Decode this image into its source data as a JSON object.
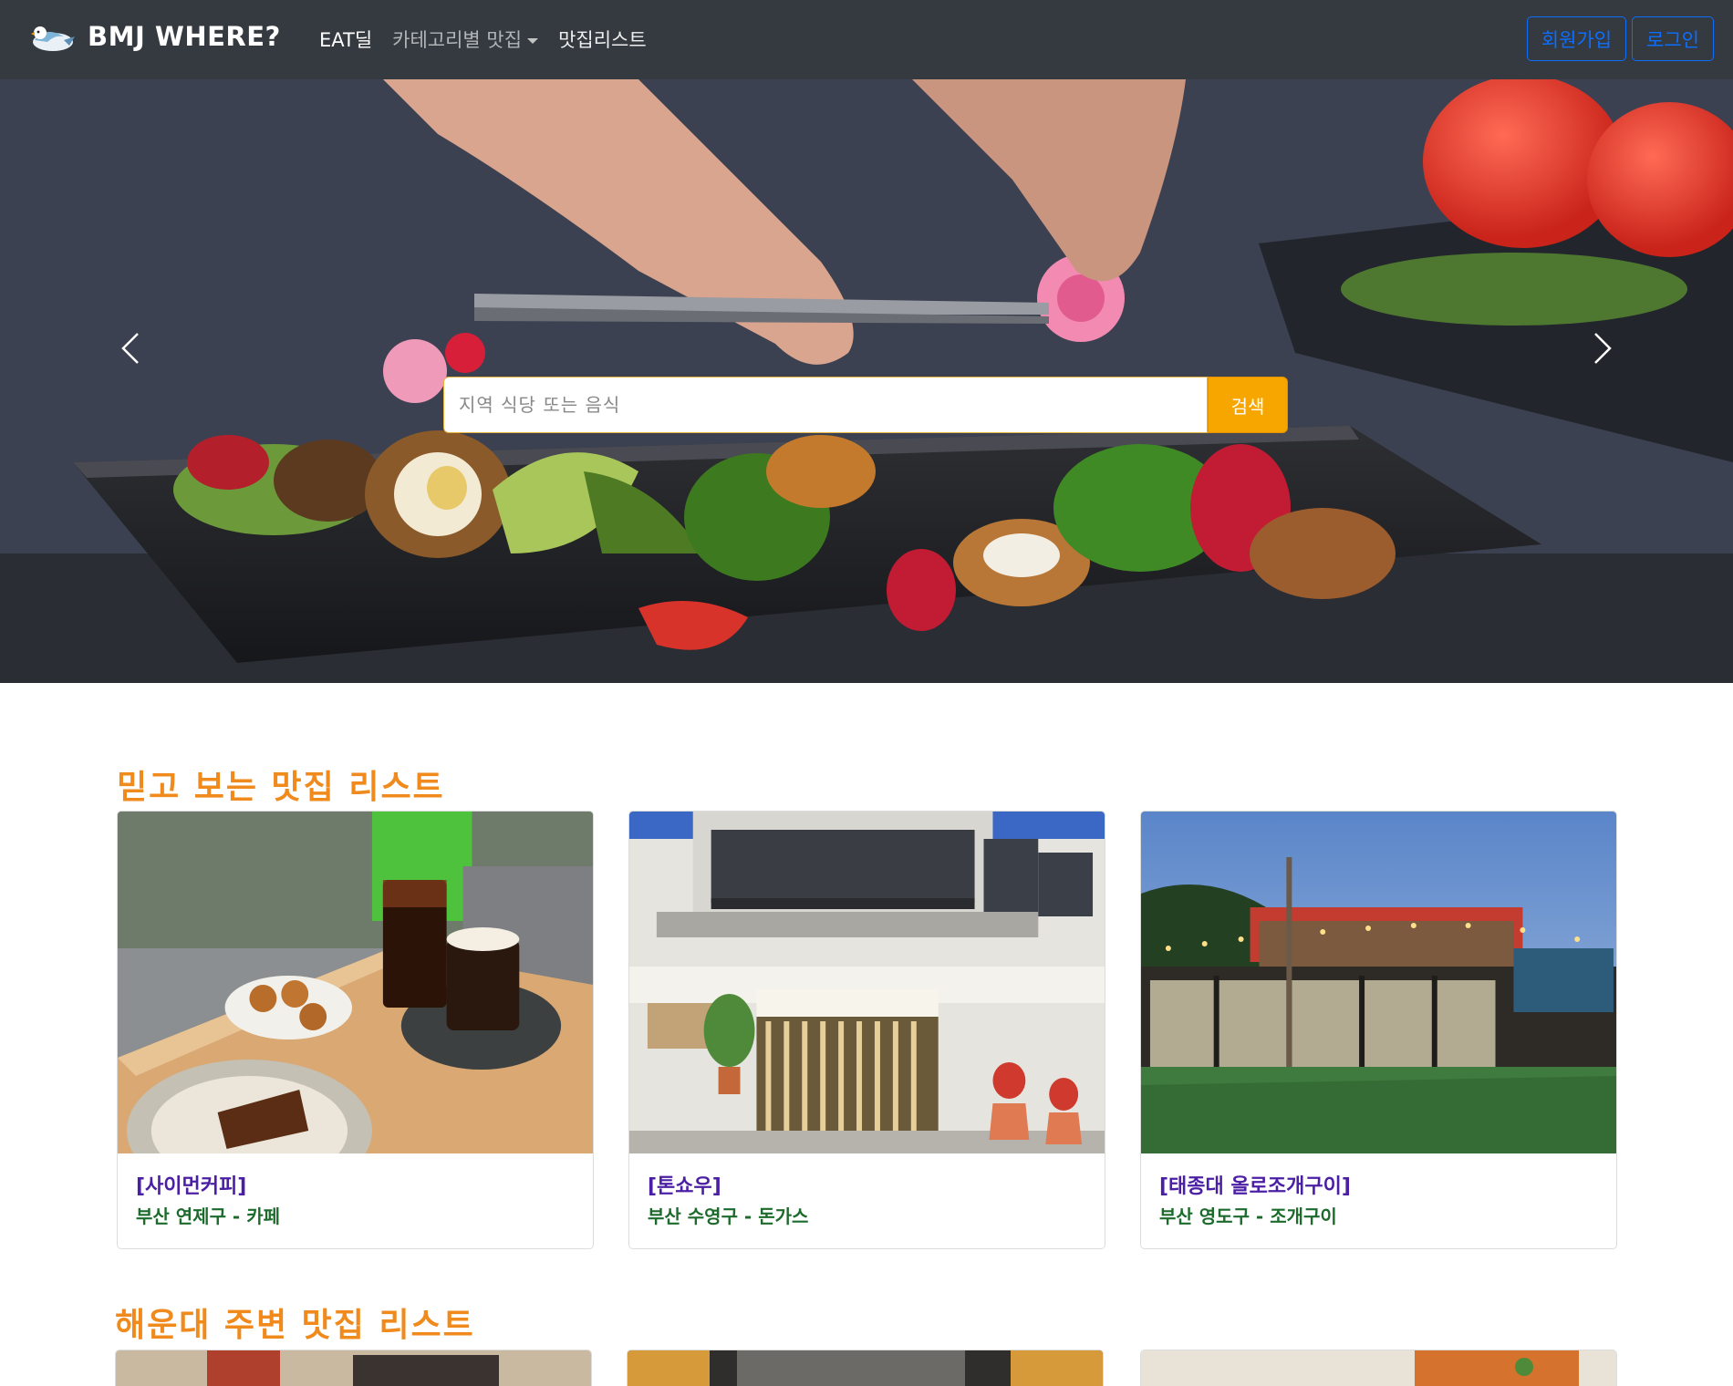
{
  "navbar": {
    "brand": "BMJ WHERE?",
    "links": [
      {
        "label": "EAT딜"
      },
      {
        "label": "카테고리별 맛집"
      },
      {
        "label": "맛집리스트"
      }
    ],
    "signup_label": "회원가입",
    "login_label": "로그인"
  },
  "hero": {
    "search_placeholder": "지역 식당 또는 음식",
    "search_button": "검색"
  },
  "sections": [
    {
      "title": "믿고 보는 맛집 리스트",
      "cards": [
        {
          "title": "[사이먼커피]",
          "subtitle": "부산 연제구 - 카페"
        },
        {
          "title": "[톤쇼우]",
          "subtitle": "부산 수영구 - 돈가스"
        },
        {
          "title": "[태종대 올로조개구이]",
          "subtitle": "부산 영도구 - 조개구이"
        }
      ]
    },
    {
      "title": "해운대 주변 맛집 리스트"
    }
  ],
  "colors": {
    "navbar_bg": "#343a40",
    "accent_orange": "#f08a1d",
    "search_button": "#f7a600",
    "auth_blue": "#0d6efd",
    "card_title": "#4b1fa3",
    "card_subtitle": "#1d6b2c"
  }
}
